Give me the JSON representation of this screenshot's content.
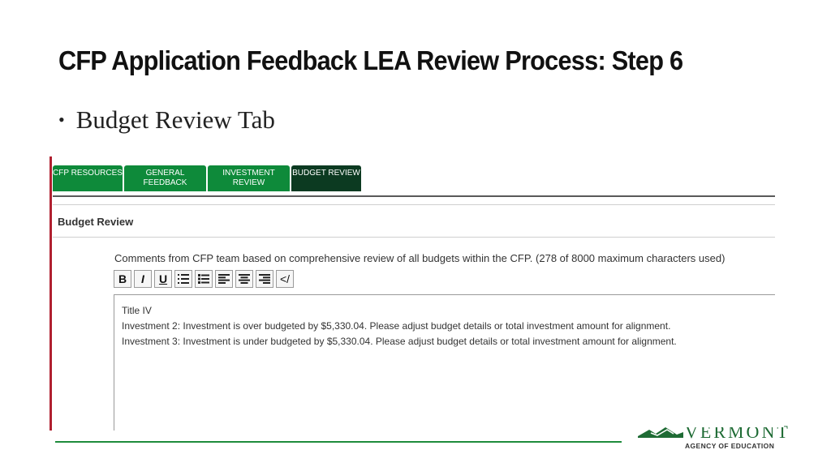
{
  "slide": {
    "title": "CFP Application Feedback LEA Review Process: Step 6",
    "bullet": "Budget Review Tab"
  },
  "tabs": [
    {
      "label": "CFP RESOURCES",
      "active": false
    },
    {
      "label": "GENERAL FEEDBACK",
      "active": false
    },
    {
      "label": "INVESTMENT REVIEW",
      "active": false
    },
    {
      "label": "BUDGET REVIEW",
      "active": true
    }
  ],
  "section": {
    "heading": "Budget Review",
    "comment_label": "Comments from CFP team based on comprehensive review of all budgets within the CFP. (278 of 8000 maximum characters used)"
  },
  "toolbar": {
    "bold": "B",
    "italic": "I",
    "underline": "U",
    "buttons": [
      "bold",
      "italic",
      "underline",
      "numbered-list-icon",
      "bulleted-list-icon",
      "align-left-icon",
      "align-center-icon",
      "align-right-icon",
      "source-code-icon"
    ],
    "source": "</"
  },
  "editor": {
    "lines": [
      "Title IV",
      "Investment 2: Investment is over budgeted by $5,330.04. Please adjust budget details or total investment amount for alignment.",
      "Investment 3: Investment is under budgeted by $5,330.04. Please adjust budget details or total investment amount for alignment."
    ]
  },
  "logo": {
    "wordmark": "VERMONT",
    "subtitle": "AGENCY OF EDUCATION"
  },
  "colors": {
    "tab_green": "#0e8a3a",
    "tab_active": "#0c3a21",
    "accent_red": "#b02030",
    "rule_green": "#1e8c3c"
  }
}
